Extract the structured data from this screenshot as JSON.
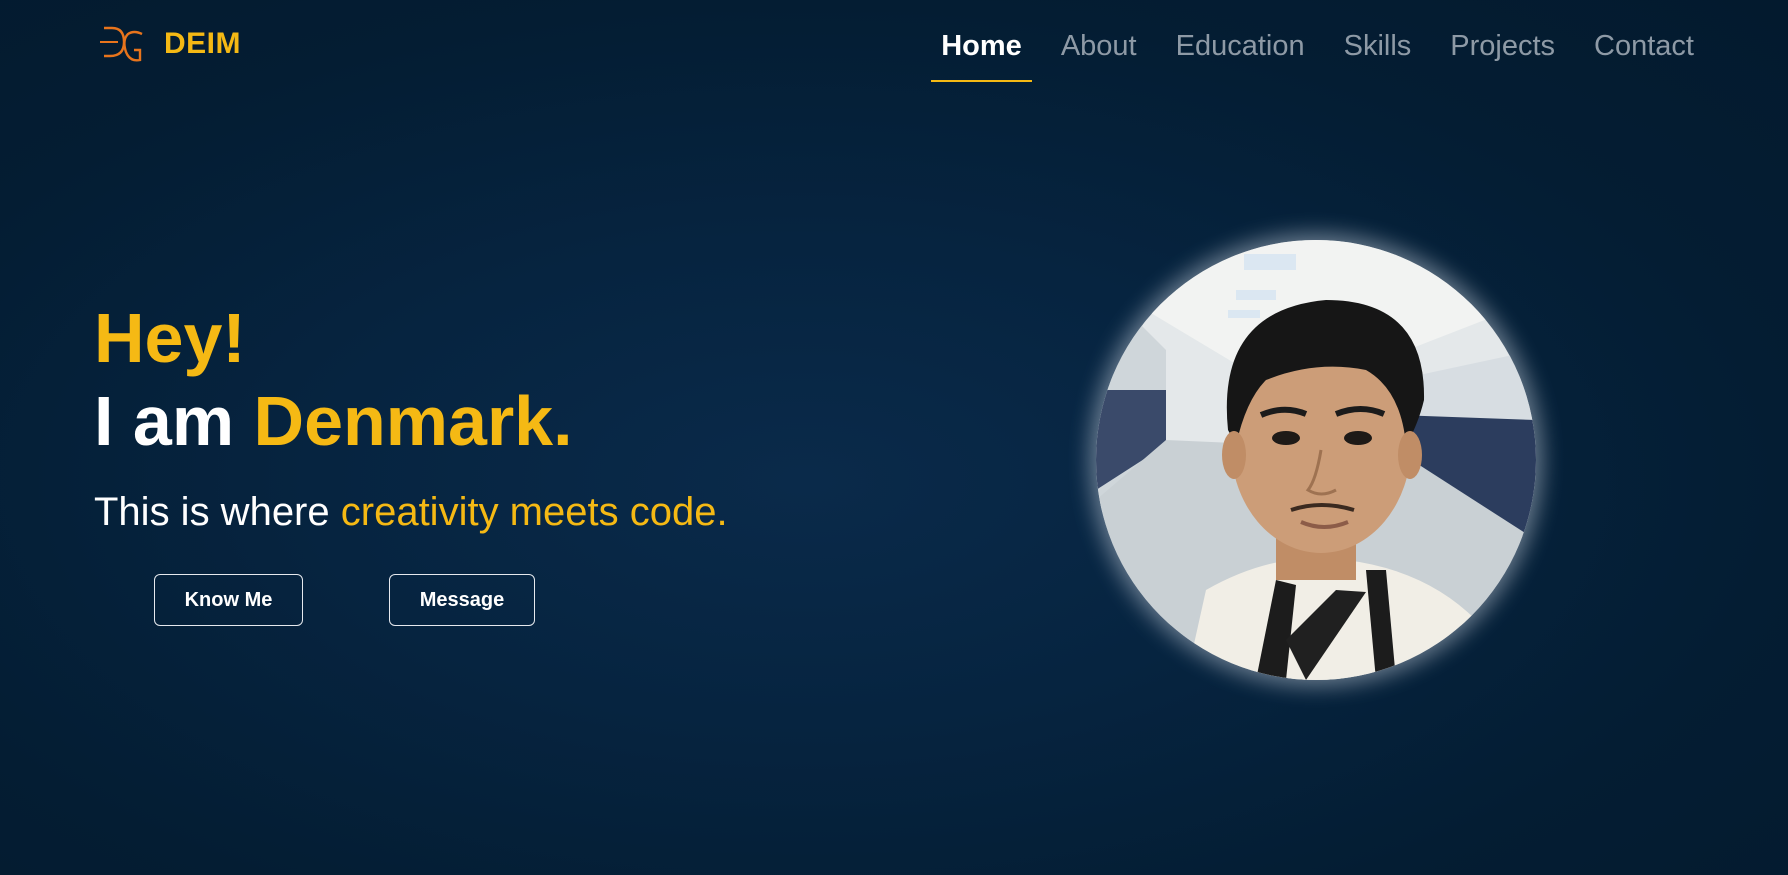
{
  "brand": {
    "name": "DEIM",
    "logo_icon": "dg-monogram-icon",
    "accent_color": "#f5b914",
    "logo_color": "#e8741c"
  },
  "nav": {
    "items": [
      {
        "label": "Home",
        "active": true
      },
      {
        "label": "About",
        "active": false
      },
      {
        "label": "Education",
        "active": false
      },
      {
        "label": "Skills",
        "active": false
      },
      {
        "label": "Projects",
        "active": false
      },
      {
        "label": "Contact",
        "active": false
      }
    ]
  },
  "hero": {
    "greeting": "Hey!",
    "name_prefix": "I am ",
    "name": "Denmark.",
    "tagline_prefix": "This is where ",
    "tagline_accent": "creativity meets code.",
    "buttons": {
      "know_me": "Know Me",
      "message": "Message"
    }
  },
  "profile_photo": {
    "icon": "profile-photo",
    "description_colors": {
      "background": "#061f38",
      "skin": "#c99a74",
      "hair": "#161616",
      "wall": "#e8ecef",
      "stripe": "#2c3d5e"
    }
  }
}
